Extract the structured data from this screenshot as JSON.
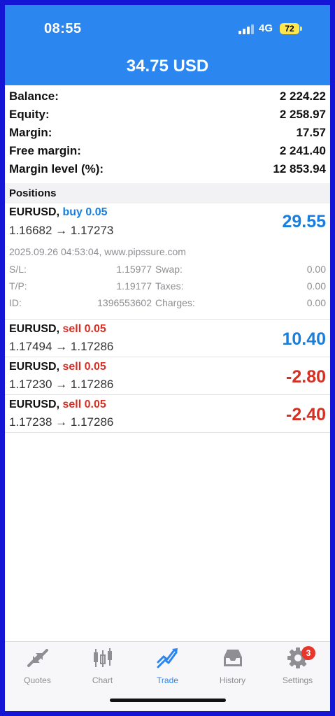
{
  "status_bar": {
    "time": "08:55",
    "network": "4G",
    "battery": "72"
  },
  "header": {
    "title": "34.75 USD"
  },
  "summary": [
    {
      "label": "Balance:",
      "value": "2 224.22"
    },
    {
      "label": "Equity:",
      "value": "2 258.97"
    },
    {
      "label": "Margin:",
      "value": "17.57"
    },
    {
      "label": "Free margin:",
      "value": "2 241.40"
    },
    {
      "label": "Margin level (%):",
      "value": "12 853.94"
    }
  ],
  "positions_header": "Positions",
  "positions": [
    {
      "symbol": "EURUSD,",
      "side": "buy 0.05",
      "prices": "1.16682 → 1.17273",
      "profit": "29.55"
    },
    {
      "symbol": "EURUSD,",
      "side": "sell 0.05",
      "prices": "1.17494 → 1.17286",
      "profit": "10.40"
    },
    {
      "symbol": "EURUSD,",
      "side": "sell 0.05",
      "prices": "1.17230 → 1.17286",
      "profit": "-2.80"
    },
    {
      "symbol": "EURUSD,",
      "side": "sell 0.05",
      "prices": "1.17238 → 1.17286",
      "profit": "-2.40"
    }
  ],
  "position_detail": {
    "meta": "2025.09.26 04:53:04, www.pipssure.com",
    "rows": [
      {
        "k1": "S/L:",
        "v1": "1.15977",
        "k2": "Swap:",
        "v2": "0.00"
      },
      {
        "k1": "T/P:",
        "v1": "1.19177",
        "k2": "Taxes:",
        "v2": "0.00"
      },
      {
        "k1": "ID:",
        "v1": "1396553602",
        "k2": "Charges:",
        "v2": "0.00"
      }
    ]
  },
  "tabs": [
    {
      "label": "Quotes",
      "icon": "quotes-arrows-icon"
    },
    {
      "label": "Chart",
      "icon": "candlestick-icon"
    },
    {
      "label": "Trade",
      "icon": "trade-trend-icon"
    },
    {
      "label": "History",
      "icon": "inbox-tray-icon"
    },
    {
      "label": "Settings",
      "icon": "gear-icon",
      "badge": "3"
    }
  ],
  "colors": {
    "accent": "#2b86f0",
    "profit": "#1a7fdc",
    "loss": "#d62f23",
    "badge": "#e8362d",
    "border": "#1515d6"
  }
}
